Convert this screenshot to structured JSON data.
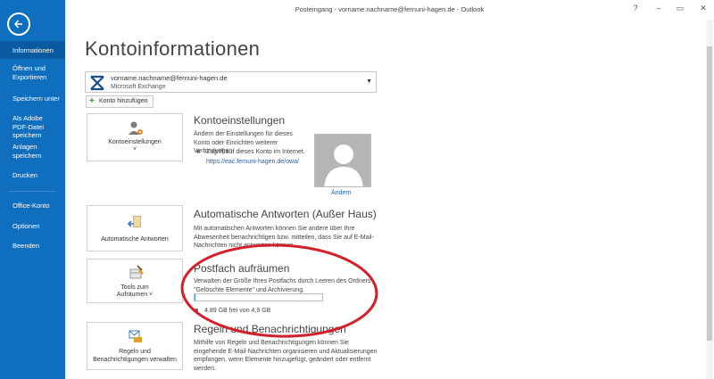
{
  "window": {
    "title": "Posteingang - vorname.nachname@fernuni-hagen.de - Outlook",
    "help": "?",
    "minimize": "–",
    "restore": "▭",
    "close": "✕"
  },
  "sidebar": {
    "items": [
      {
        "label": "Informationen"
      },
      {
        "label": "Öffnen und Exportieren"
      },
      {
        "label": "Speichern unter"
      },
      {
        "label": "Als Adobe PDF-Datei speichern"
      },
      {
        "label": "Anlagen speichern"
      },
      {
        "label": "Drucken"
      },
      {
        "label": "Office-Konto"
      },
      {
        "label": "Optionen"
      },
      {
        "label": "Beenden"
      }
    ]
  },
  "page": {
    "title": "Kontoinformationen"
  },
  "account": {
    "email": "vorname.nachname@fernuni-hagen.de",
    "type": "Microsoft Exchange",
    "add_label": "Konto hinzufügen"
  },
  "settings": {
    "tile_label": "Kontoeinstellungen",
    "tile_caret": "˅",
    "title": "Kontoeinstellungen",
    "text": "Ändern der Einstellungen für dieses Konto oder Einrichten weiterer Verbindungen.",
    "bullet": "Zugriff auf dieses Konto im Internet.",
    "link": "https://eac.fernuni-hagen.de/owa/",
    "photo_change": "Ändern"
  },
  "auto_reply": {
    "tile_label": "Automatische Antworten",
    "title": "Automatische Antworten (Außer Haus)",
    "text": "Mit automatischen Antworten können Sie andere über Ihre Abwesenheit benachrichtigen bzw. mitteilen, dass Sie auf E-Mail-Nachrichten nicht antworten können."
  },
  "cleanup": {
    "tile_label_1": "Tools zum",
    "tile_label_2": "Aufräumen ˅",
    "title": "Postfach aufräumen",
    "text": "Verwalten der Größe Ihres Postfachs durch Leeren des Ordners \"Gelöschte Elemente\" und Archivierung.",
    "quota_fraction": 0.01,
    "quota_text": "4,89 GB frei von 4,9 GB"
  },
  "rules": {
    "tile_label_1": "Regeln und",
    "tile_label_2": "Benachrichtigungen verwalten",
    "title": "Regeln und Benachrichtigungen",
    "text": "Mithilfe von Regeln und Benachrichtigungen können Sie eingehende E-Mail-Nachrichten organisieren und Aktualisierungen empfangen, wenn Elemente hinzugefügt, geändert oder entfernt werden."
  },
  "colors": {
    "sidebar": "#106ebe",
    "highlight_circle": "#d4202a",
    "link": "#2a5fa8",
    "quota": "#3aa0d8"
  }
}
